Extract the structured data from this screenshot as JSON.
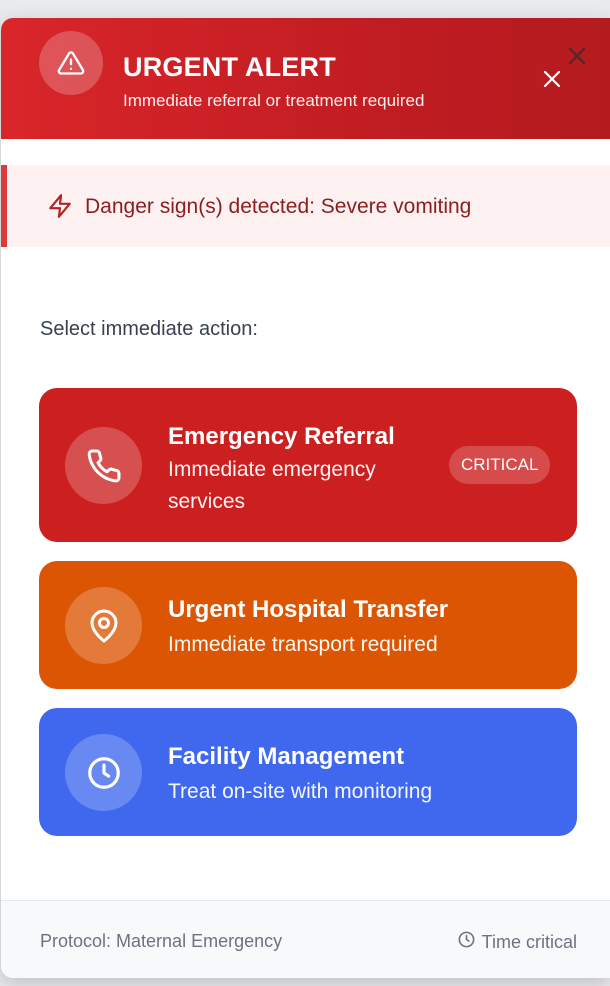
{
  "header": {
    "title": "URGENT ALERT",
    "subtitle": "Immediate referral or treatment required",
    "icon": "alert-triangle-icon",
    "close_icon": "close-icon"
  },
  "danger": {
    "icon": "lightning-icon",
    "text": "Danger sign(s) detected: Severe vomiting"
  },
  "actions": {
    "label": "Select immediate action:",
    "items": [
      {
        "title": "Emergency Referral",
        "description": "Immediate emergency services",
        "badge": "CRITICAL",
        "icon": "phone-icon",
        "color": "#cc1f1f"
      },
      {
        "title": "Urgent Hospital Transfer",
        "description": "Immediate transport required",
        "icon": "map-pin-icon",
        "color": "#dc5503"
      },
      {
        "title": "Facility Management",
        "description": "Treat on-site with monitoring",
        "icon": "clock-icon",
        "color": "#3f68ef"
      }
    ]
  },
  "footer": {
    "protocol": "Protocol: Maternal Emergency",
    "time": "Time critical",
    "time_icon": "clock-icon"
  },
  "colors": {
    "header_red": "#cc2226",
    "banner_bg": "#fdf1f1",
    "banner_text": "#8d1d1d"
  }
}
